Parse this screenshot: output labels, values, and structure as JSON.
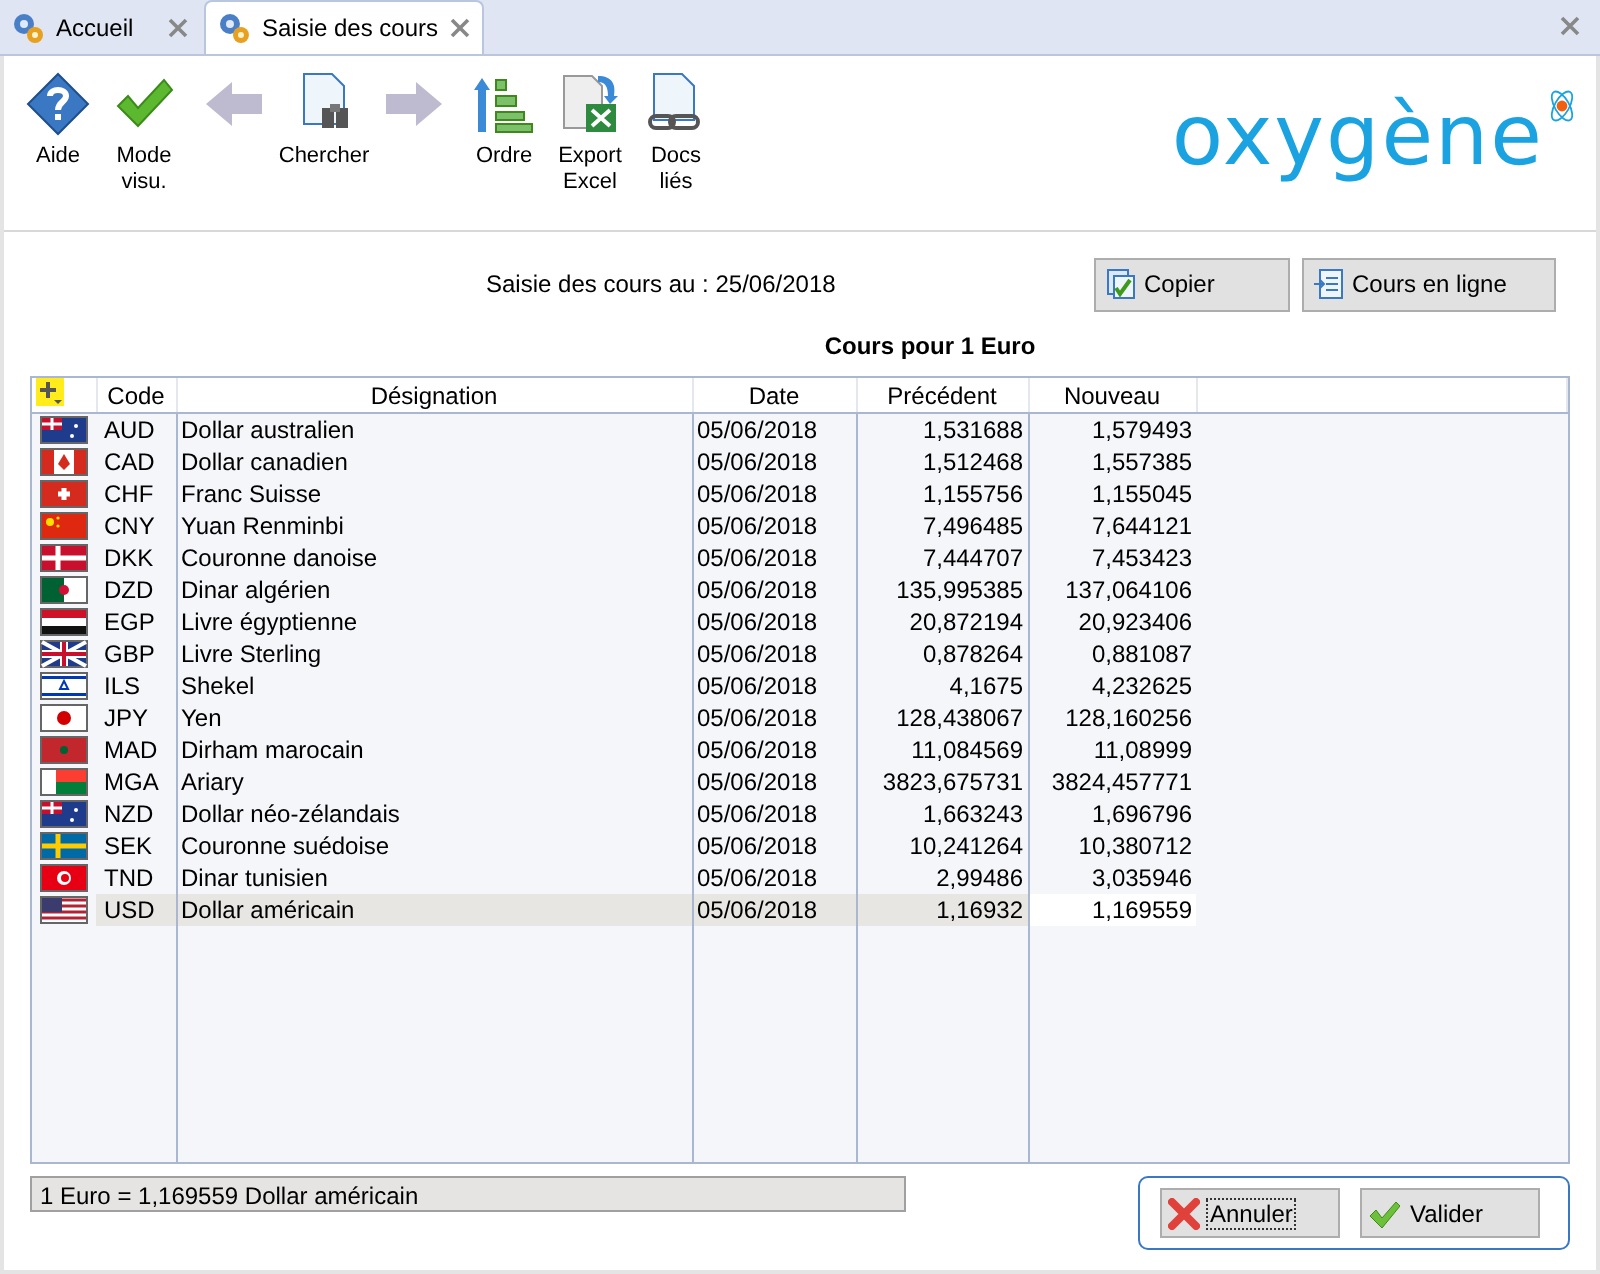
{
  "tabs": [
    {
      "label": "Accueil",
      "selected": false
    },
    {
      "label": "Saisie des cours",
      "selected": true
    }
  ],
  "toolbar": [
    {
      "kind": "help",
      "label": "Aide",
      "disabled": false
    },
    {
      "kind": "check",
      "label": "Mode visu.",
      "disabled": false
    },
    {
      "kind": "back",
      "disabled": true
    },
    {
      "kind": "search",
      "label": "Chercher",
      "disabled": false
    },
    {
      "kind": "forward",
      "disabled": true
    },
    {
      "kind": "order",
      "label": "Ordre",
      "disabled": false
    },
    {
      "kind": "excel",
      "label": "Export Excel",
      "disabled": false
    },
    {
      "kind": "docs",
      "label": "Docs liés",
      "disabled": false
    }
  ],
  "logo": "oxygène",
  "heading": "Saisie des cours au : 25/06/2018",
  "actions": [
    {
      "kind": "copy",
      "label": "Copier"
    },
    {
      "kind": "online",
      "label": "Cours en ligne"
    }
  ],
  "subtitle": "Cours pour 1 Euro",
  "table": {
    "columns": [
      "Code",
      "Désignation",
      "Date",
      "Précédent",
      "Nouveau"
    ],
    "rows": [
      {
        "code": "AUD",
        "name": "Dollar australien",
        "date": "05/06/2018",
        "prev": "1,531688",
        "new": "1,579493",
        "selected": false
      },
      {
        "code": "CAD",
        "name": "Dollar canadien",
        "date": "05/06/2018",
        "prev": "1,512468",
        "new": "1,557385",
        "selected": false
      },
      {
        "code": "CHF",
        "name": "Franc Suisse",
        "date": "05/06/2018",
        "prev": "1,155756",
        "new": "1,155045",
        "selected": false
      },
      {
        "code": "CNY",
        "name": "Yuan Renminbi",
        "date": "05/06/2018",
        "prev": "7,496485",
        "new": "7,644121",
        "selected": false
      },
      {
        "code": "DKK",
        "name": "Couronne danoise",
        "date": "05/06/2018",
        "prev": "7,444707",
        "new": "7,453423",
        "selected": false
      },
      {
        "code": "DZD",
        "name": "Dinar algérien",
        "date": "05/06/2018",
        "prev": "135,995385",
        "new": "137,064106",
        "selected": false
      },
      {
        "code": "EGP",
        "name": "Livre égyptienne",
        "date": "05/06/2018",
        "prev": "20,872194",
        "new": "20,923406",
        "selected": false
      },
      {
        "code": "GBP",
        "name": "Livre Sterling",
        "date": "05/06/2018",
        "prev": "0,878264",
        "new": "0,881087",
        "selected": false
      },
      {
        "code": "ILS",
        "name": "Shekel",
        "date": "05/06/2018",
        "prev": "4,1675",
        "new": "4,232625",
        "selected": false
      },
      {
        "code": "JPY",
        "name": "Yen",
        "date": "05/06/2018",
        "prev": "128,438067",
        "new": "128,160256",
        "selected": false
      },
      {
        "code": "MAD",
        "name": "Dirham marocain",
        "date": "05/06/2018",
        "prev": "11,084569",
        "new": "11,08999",
        "selected": false
      },
      {
        "code": "MGA",
        "name": "Ariary",
        "date": "05/06/2018",
        "prev": "3823,675731",
        "new": "3824,457771",
        "selected": false
      },
      {
        "code": "NZD",
        "name": "Dollar néo-zélandais",
        "date": "05/06/2018",
        "prev": "1,663243",
        "new": "1,696796",
        "selected": false
      },
      {
        "code": "SEK",
        "name": "Couronne suédoise",
        "date": "05/06/2018",
        "prev": "10,241264",
        "new": "10,380712",
        "selected": false
      },
      {
        "code": "TND",
        "name": "Dinar tunisien",
        "date": "05/06/2018",
        "prev": "2,99486",
        "new": "3,035946",
        "selected": false
      },
      {
        "code": "USD",
        "name": "Dollar américain",
        "date": "05/06/2018",
        "prev": "1,16932",
        "new": "1,169559",
        "selected": true
      }
    ]
  },
  "status": "1 Euro = 1,169559 Dollar américain",
  "buttons": [
    {
      "kind": "cancel",
      "label": "Annuler",
      "focused": true
    },
    {
      "kind": "ok",
      "label": "Valider",
      "focused": false
    }
  ]
}
